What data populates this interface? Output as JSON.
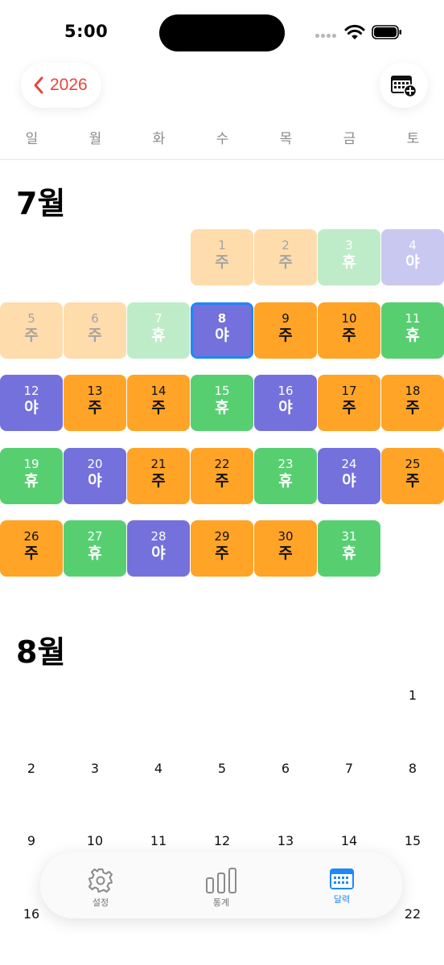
{
  "status": {
    "time": "5:00"
  },
  "header": {
    "year": "2026"
  },
  "weekdays": [
    "일",
    "월",
    "화",
    "수",
    "목",
    "금",
    "토"
  ],
  "colors": {
    "day": "#ffa427",
    "rest": "#57cf71",
    "night": "#7471dc",
    "accent": "#1e88f5",
    "back": "#e8453c"
  },
  "july": {
    "title": "7월",
    "days": [
      {
        "n": "1",
        "c": "주"
      },
      {
        "n": "2",
        "c": "주"
      },
      {
        "n": "3",
        "c": "휴"
      },
      {
        "n": "4",
        "c": "야"
      },
      {
        "n": "5",
        "c": "주"
      },
      {
        "n": "6",
        "c": "주"
      },
      {
        "n": "7",
        "c": "휴"
      },
      {
        "n": "8",
        "c": "야"
      },
      {
        "n": "9",
        "c": "주"
      },
      {
        "n": "10",
        "c": "주"
      },
      {
        "n": "11",
        "c": "휴"
      },
      {
        "n": "12",
        "c": "야"
      },
      {
        "n": "13",
        "c": "주"
      },
      {
        "n": "14",
        "c": "주"
      },
      {
        "n": "15",
        "c": "휴"
      },
      {
        "n": "16",
        "c": "야"
      },
      {
        "n": "17",
        "c": "주"
      },
      {
        "n": "18",
        "c": "주"
      },
      {
        "n": "19",
        "c": "휴"
      },
      {
        "n": "20",
        "c": "야"
      },
      {
        "n": "21",
        "c": "주"
      },
      {
        "n": "22",
        "c": "주"
      },
      {
        "n": "23",
        "c": "휴"
      },
      {
        "n": "24",
        "c": "야"
      },
      {
        "n": "25",
        "c": "주"
      },
      {
        "n": "26",
        "c": "주"
      },
      {
        "n": "27",
        "c": "휴"
      },
      {
        "n": "28",
        "c": "야"
      },
      {
        "n": "29",
        "c": "주"
      },
      {
        "n": "30",
        "c": "주"
      },
      {
        "n": "31",
        "c": "휴"
      }
    ]
  },
  "august": {
    "title": "8월",
    "days": [
      "1",
      "2",
      "3",
      "4",
      "5",
      "6",
      "7",
      "8",
      "9",
      "10",
      "11",
      "12",
      "13",
      "14",
      "15",
      "16",
      "22"
    ]
  },
  "tabs": [
    {
      "label": "설정",
      "icon": "gear-icon"
    },
    {
      "label": "통계",
      "icon": "bar-chart-icon"
    },
    {
      "label": "달력",
      "icon": "calendar-icon"
    }
  ]
}
